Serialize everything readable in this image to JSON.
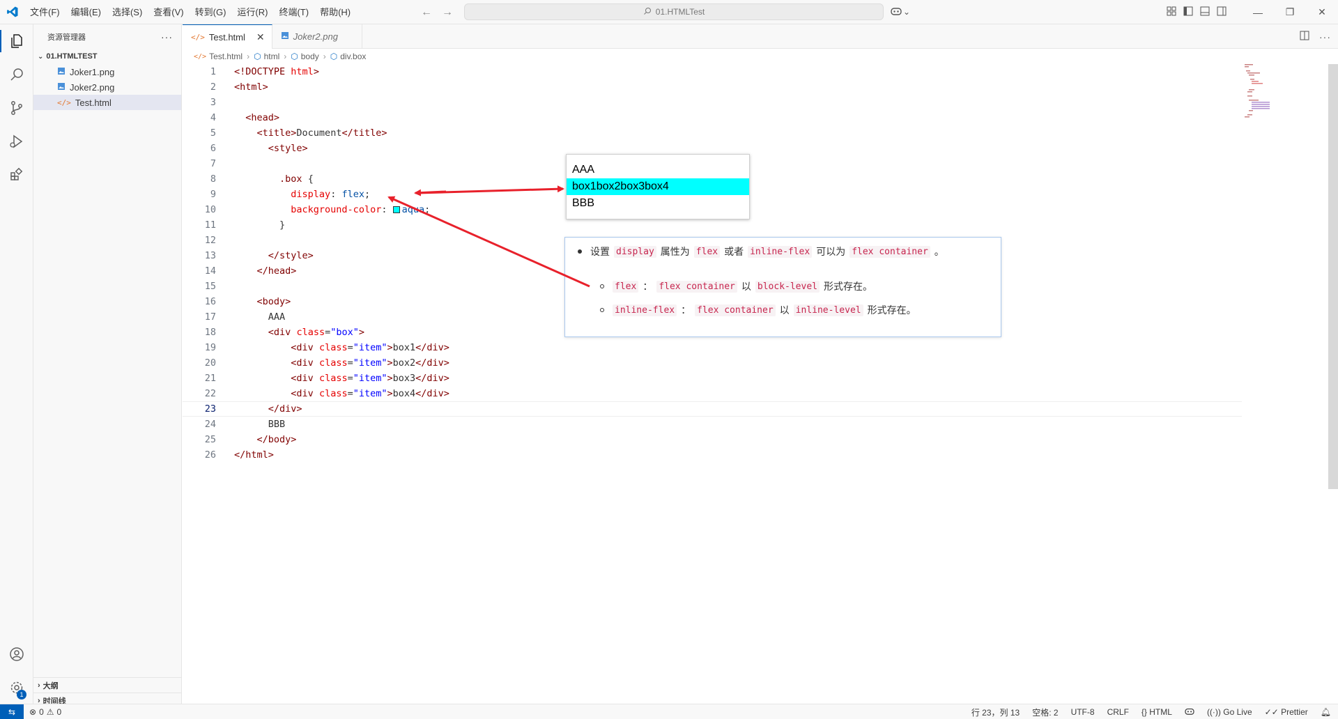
{
  "menu": [
    "文件(F)",
    "编辑(E)",
    "选择(S)",
    "查看(V)",
    "转到(G)",
    "运行(R)",
    "终端(T)",
    "帮助(H)"
  ],
  "command_center": {
    "text": "01.HTMLTest"
  },
  "sidebar": {
    "title": "资源管理器",
    "folder": "01.HTMLTEST",
    "files": [
      "Joker1.png",
      "Joker2.png",
      "Test.html"
    ],
    "sections": [
      "大纲",
      "时间线"
    ]
  },
  "tabs": [
    {
      "label": "Test.html",
      "active": true
    },
    {
      "label": "Joker2.png",
      "active": false
    }
  ],
  "breadcrumb": [
    "Test.html",
    "html",
    "body",
    "div.box"
  ],
  "code_lines": [
    "1",
    "2",
    "3",
    "4",
    "5",
    "6",
    "7",
    "8",
    "9",
    "10",
    "11",
    "12",
    "13",
    "14",
    "15",
    "16",
    "17",
    "18",
    "19",
    "20",
    "21",
    "22",
    "23",
    "24",
    "25",
    "26"
  ],
  "code": {
    "l1a": "<!DOCTYPE",
    "l1b": "html",
    "l1c": ">",
    "l2": "<html>",
    "l4": "<head>",
    "l5a": "<title>",
    "l5b": "Document",
    "l5c": "</title>",
    "l6": "<style>",
    "l8a": ".box",
    "l8b": "{",
    "l9a": "display",
    "l9b": ":",
    "l9c": "flex",
    "l9d": ";",
    "l10a": "background-color",
    "l10b": ":",
    "l10c": "aqua",
    "l10d": ";",
    "l11": "}",
    "l13": "</style>",
    "l14": "</head>",
    "l16": "<body>",
    "l17": "AAA",
    "l18a": "<div",
    "l18b": "class",
    "l18c": "=",
    "l18d": "\"box\"",
    "l18e": ">",
    "item_open": "<div",
    "item_attr": "class",
    "item_eq": "=",
    "item_val": "\"item\"",
    "item_gt": ">",
    "l19t": "box1",
    "l20t": "box2",
    "l21t": "box3",
    "l22t": "box4",
    "item_close": "</div>",
    "l23": "</div>",
    "l24": "BBB",
    "l25": "</body>",
    "l26": "</html>"
  },
  "preview": {
    "line1": "AAA",
    "line2": "box1box2box3box4",
    "line3": "BBB",
    "flex_bg": "#00ffff"
  },
  "notes": {
    "n1_a": "设置",
    "n1_code1": "display",
    "n1_b": "属性为",
    "n1_code2": "flex",
    "n1_c": "或者",
    "n1_code3": "inline-flex",
    "n1_d": "可以为",
    "n1_code4": "flex container",
    "n1_e": "。",
    "n2_code1": "flex",
    "n2_a": "：",
    "n2_code2": "flex container",
    "n2_b": "以",
    "n2_code3": "block-level",
    "n2_c": "形式存在。",
    "n3_code1": "inline-flex",
    "n3_a": "：",
    "n3_code2": "flex container",
    "n3_b": "以",
    "n3_code3": "inline-level",
    "n3_c": "形式存在。"
  },
  "status": {
    "errors": "0",
    "warnings": "0",
    "position": "行 23，列 13",
    "spaces": "空格: 2",
    "encoding": "UTF-8",
    "eol": "CRLF",
    "language": "HTML",
    "golive": "Go Live",
    "prettier": "Prettier"
  },
  "colors": {
    "accent": "#005fb8",
    "arrow": "#e8212b"
  }
}
